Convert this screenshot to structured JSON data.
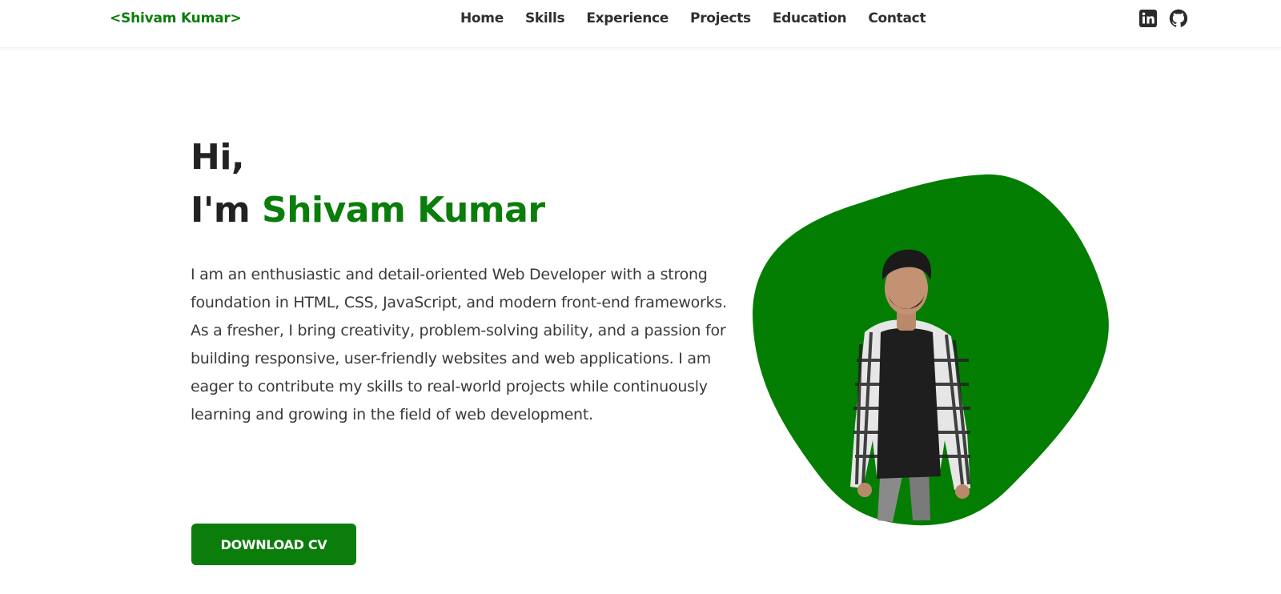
{
  "nav": {
    "logo": "<Shivam Kumar>",
    "links": [
      "Home",
      "Skills",
      "Experience",
      "Projects",
      "Education",
      "Contact"
    ]
  },
  "social": {
    "linkedin_icon": "linkedin-icon",
    "github_icon": "github-icon"
  },
  "hero": {
    "greeting": "Hi,",
    "intro_prefix": "I'm ",
    "name": "Shivam Kumar",
    "bio": "I am an enthusiastic and detail-oriented Web Developer with a strong foundation in HTML, CSS, JavaScript, and modern front-end frameworks. As a fresher, I bring creativity, problem-solving ability, and a passion for building responsive, user-friendly websites and web applications. I am eager to contribute my skills to real-world projects while continuously learning and growing in the field of web development.",
    "cv_button": "DOWNLOAD CV"
  },
  "colors": {
    "accent": "#0a7d0a",
    "text": "#2b2b2b",
    "background": "#ffffff"
  }
}
